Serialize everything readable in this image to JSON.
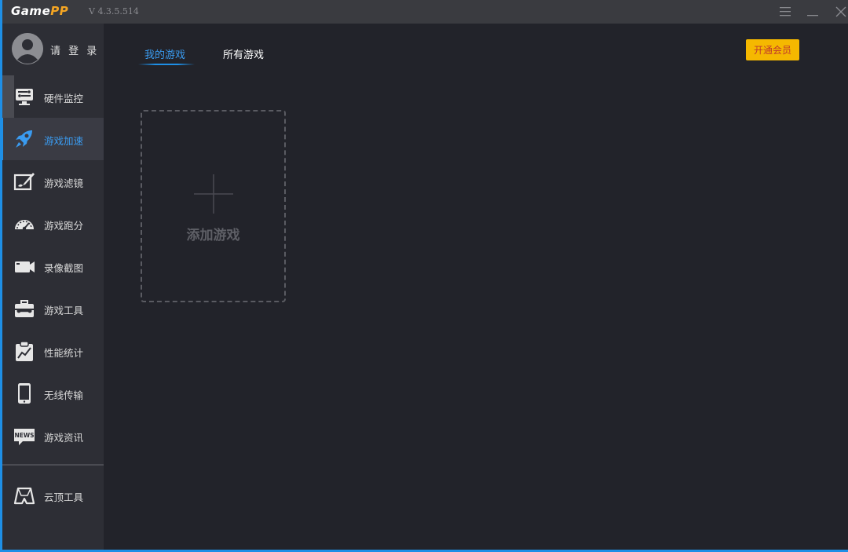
{
  "app": {
    "logo_main": "Game",
    "logo_accent": "PP",
    "version": "V 4.3.5.514"
  },
  "user": {
    "login_label": "请 登 录"
  },
  "sidebar": {
    "items": [
      {
        "label": "硬件监控",
        "icon": "hardware-monitor-icon"
      },
      {
        "label": "游戏加速",
        "icon": "rocket-icon"
      },
      {
        "label": "游戏滤镜",
        "icon": "filter-brush-icon"
      },
      {
        "label": "游戏跑分",
        "icon": "speedometer-icon"
      },
      {
        "label": "录像截图",
        "icon": "video-camera-icon"
      },
      {
        "label": "游戏工具",
        "icon": "toolbox-icon"
      },
      {
        "label": "性能统计",
        "icon": "chart-clipboard-icon"
      },
      {
        "label": "无线传输",
        "icon": "tablet-icon"
      },
      {
        "label": "游戏资讯",
        "icon": "news-icon"
      }
    ],
    "footer_item": {
      "label": "云顶工具",
      "icon": "cloud-tool-icon"
    },
    "news_badge": "NEWS"
  },
  "tabs": {
    "my_games": "我的游戏",
    "all_games": "所有游戏"
  },
  "vip_button": "开通会员",
  "add_game_label": "添加游戏",
  "colors": {
    "accent": "#1e8fe6",
    "vip": "#f5b800",
    "vip_text": "#c0392b"
  }
}
